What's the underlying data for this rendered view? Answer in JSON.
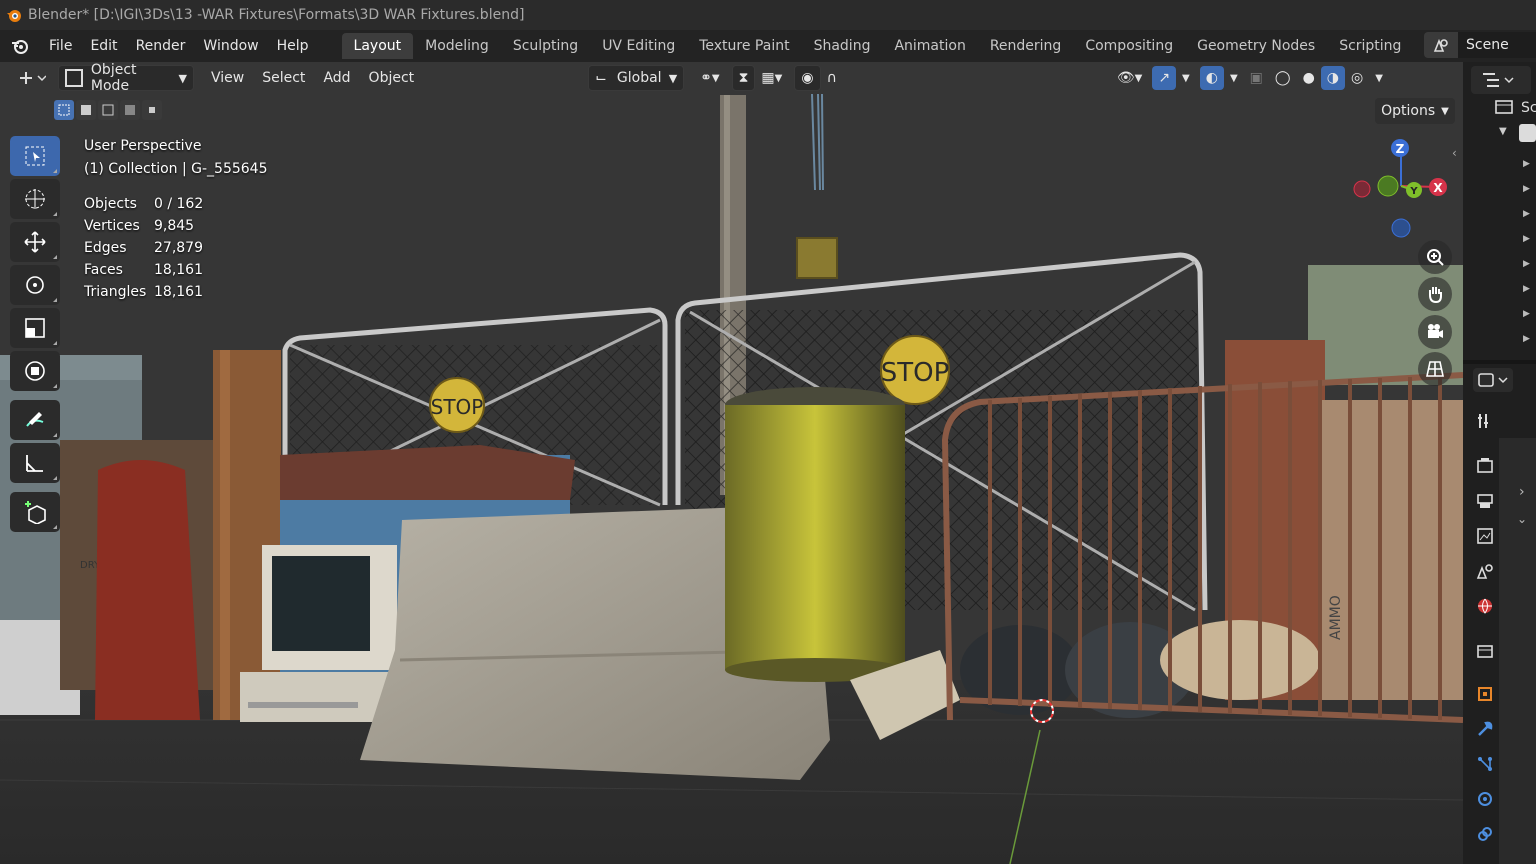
{
  "window": {
    "title": "Blender* [D:\\IGI\\3Ds\\13 -WAR Fixtures\\Formats\\3D WAR Fixtures.blend]"
  },
  "menu": [
    "File",
    "Edit",
    "Render",
    "Window",
    "Help"
  ],
  "workspaces": [
    "Layout",
    "Modeling",
    "Sculpting",
    "UV Editing",
    "Texture Paint",
    "Shading",
    "Animation",
    "Rendering",
    "Compositing",
    "Geometry Nodes",
    "Scripting"
  ],
  "active_workspace": "Layout",
  "scene": {
    "name": "Scene"
  },
  "viewport_header": {
    "mode": "Object Mode",
    "menus": [
      "View",
      "Select",
      "Add",
      "Object"
    ],
    "orientation": "Global",
    "options_label": "Options"
  },
  "overlay_info": {
    "perspective": "User Perspective",
    "collection": "(1) Collection | G-_555645"
  },
  "stats": [
    {
      "label": "Objects",
      "value": "0 / 162"
    },
    {
      "label": "Vertices",
      "value": "9,845"
    },
    {
      "label": "Edges",
      "value": "27,879"
    },
    {
      "label": "Faces",
      "value": "18,161"
    },
    {
      "label": "Triangles",
      "value": "18,161"
    }
  ],
  "gizmo_labels": {
    "z": "Z",
    "y": "Y",
    "x": "X"
  },
  "scene_props": {
    "sign_text": "STOP",
    "crate_text": "AMMO",
    "box_text": "DRY SECH SECA"
  },
  "outliner_partial": "Sc",
  "colors": {
    "accent": "#4772b3",
    "background": "#303030",
    "header": "#232323"
  }
}
